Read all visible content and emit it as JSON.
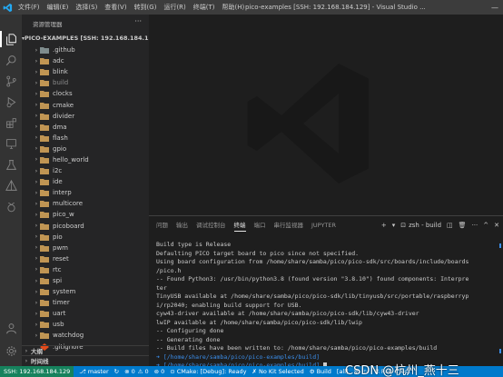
{
  "window": {
    "title": "pico-examples [SSH: 192.168.184.129] - Visual Studio ...",
    "menu": [
      "文件(F)",
      "编辑(E)",
      "选择(S)",
      "查看(V)",
      "转到(G)",
      "运行(R)",
      "终端(T)",
      "帮助(H)"
    ]
  },
  "sidebar": {
    "title": "资源管理器",
    "section": "PICO-EXAMPLES [SSH: 192.168.184.129]",
    "items": [
      {
        "label": ".github",
        "kind": "folder",
        "dim": false
      },
      {
        "label": "adc",
        "kind": "folder",
        "dim": false
      },
      {
        "label": "blink",
        "kind": "folder",
        "dim": false
      },
      {
        "label": "build",
        "kind": "folder",
        "dim": true
      },
      {
        "label": "clocks",
        "kind": "folder",
        "dim": false
      },
      {
        "label": "cmake",
        "kind": "folder",
        "dim": false
      },
      {
        "label": "divider",
        "kind": "folder",
        "dim": false
      },
      {
        "label": "dma",
        "kind": "folder",
        "dim": false
      },
      {
        "label": "flash",
        "kind": "folder",
        "dim": false
      },
      {
        "label": "gpio",
        "kind": "folder",
        "dim": false
      },
      {
        "label": "hello_world",
        "kind": "folder",
        "dim": false
      },
      {
        "label": "i2c",
        "kind": "folder",
        "dim": false
      },
      {
        "label": "ide",
        "kind": "folder",
        "dim": false
      },
      {
        "label": "interp",
        "kind": "folder",
        "dim": false
      },
      {
        "label": "multicore",
        "kind": "folder",
        "dim": false
      },
      {
        "label": "pico_w",
        "kind": "folder",
        "dim": false
      },
      {
        "label": "picoboard",
        "kind": "folder",
        "dim": false
      },
      {
        "label": "pio",
        "kind": "folder",
        "dim": false
      },
      {
        "label": "pwm",
        "kind": "folder",
        "dim": false
      },
      {
        "label": "reset",
        "kind": "folder",
        "dim": false
      },
      {
        "label": "rtc",
        "kind": "folder",
        "dim": false
      },
      {
        "label": "spi",
        "kind": "folder",
        "dim": false
      },
      {
        "label": "system",
        "kind": "folder",
        "dim": false
      },
      {
        "label": "timer",
        "kind": "folder",
        "dim": false
      },
      {
        "label": "uart",
        "kind": "folder",
        "dim": false
      },
      {
        "label": "usb",
        "kind": "folder",
        "dim": false
      },
      {
        "label": "watchdog",
        "kind": "folder",
        "dim": false
      },
      {
        "label": ".gitignore",
        "kind": "git",
        "dim": false
      }
    ],
    "outline_label": "大纲",
    "timeline_label": "时间线"
  },
  "panel": {
    "tabs": [
      "问题",
      "输出",
      "调试控制台",
      "终端",
      "端口",
      "串行监视器",
      "JUPYTER"
    ],
    "active_tab": "终端",
    "terminal_name": "zsh - build",
    "lines": [
      "Build type is Release",
      "Defaulting PICO target board to pico since not specified.",
      "Using board configuration from /home/share/samba/pico/pico-sdk/src/boards/include/boards",
      "/pico.h",
      "-- Found Python3: /usr/bin/python3.8 (found version \"3.8.10\") found components: Interpre",
      "ter",
      "TinyUSB available at /home/share/samba/pico/pico-sdk/lib/tinyusb/src/portable/raspberryp",
      "i/rp2040; enabling build support for USB.",
      "cyw43-driver available at /home/share/samba/pico/pico-sdk/lib/cyw43-driver",
      "lwIP available at /home/share/samba/pico/pico-sdk/lib/lwip",
      "-- Configuring done",
      "-- Generating done",
      "-- Build files have been written to: /home/share/samba/pico/pico-examples/build"
    ],
    "prompt1": "[/home/share/samba/pico/pico-examples/build]",
    "prompt2": "[/home/share/samba/pico/pico-examples/build]",
    "prompt_mark": "➜"
  },
  "statusbar": {
    "remote": "SSH: 192.168.184.129",
    "branch": "master",
    "errors": "0",
    "warnings": "0",
    "ports": "0",
    "cmake": "CMake: [Debug]: Ready",
    "kit": "No Kit Selected",
    "build": "Build",
    "target": "[all]",
    "run_ctest": "Run CTest"
  },
  "watermark_text": "CSDN @杭州_燕十三",
  "colors": {
    "accent": "#007acc",
    "remote": "#16825d",
    "folder": "#c09553",
    "git_icon": "#e64a19"
  }
}
